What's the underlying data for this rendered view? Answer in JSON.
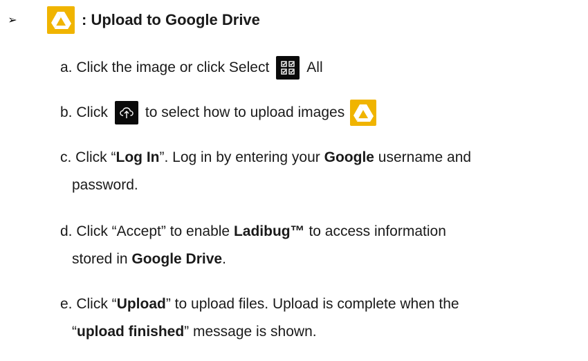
{
  "heading": {
    "bullet": "➢",
    "title": ": Upload to Google Drive",
    "icon": "google-drive-icon"
  },
  "steps": {
    "a": {
      "prefix": "a.  Click the image or click Select",
      "icon": "select-all-icon",
      "suffix": "All"
    },
    "b": {
      "prefix": "b.  Click",
      "icon": "cloud-upload-icon",
      "middle": "to select how to upload images",
      "icon2": "google-drive-icon"
    },
    "c": {
      "t1": "c.  Click “",
      "b1": "Log In",
      "t2": "”. Log in by entering your ",
      "b2": "Google",
      "t3": " username and",
      "line2": "password."
    },
    "d": {
      "t1": "d.  Click “Accept” to enable ",
      "b1": "Ladibug™",
      "t2": " to access information",
      "t3": "stored in ",
      "b2": "Google Drive",
      "t4": "."
    },
    "e": {
      "t1": "e.  Click “",
      "b1": "Upload",
      "t2": "” to upload files. Upload is complete when the",
      "t3": "“",
      "b2": "upload finished",
      "t4": "” message is shown."
    }
  },
  "colors": {
    "drive_bg": "#f0b400",
    "dark_icon_bg": "#0a0a0a"
  }
}
